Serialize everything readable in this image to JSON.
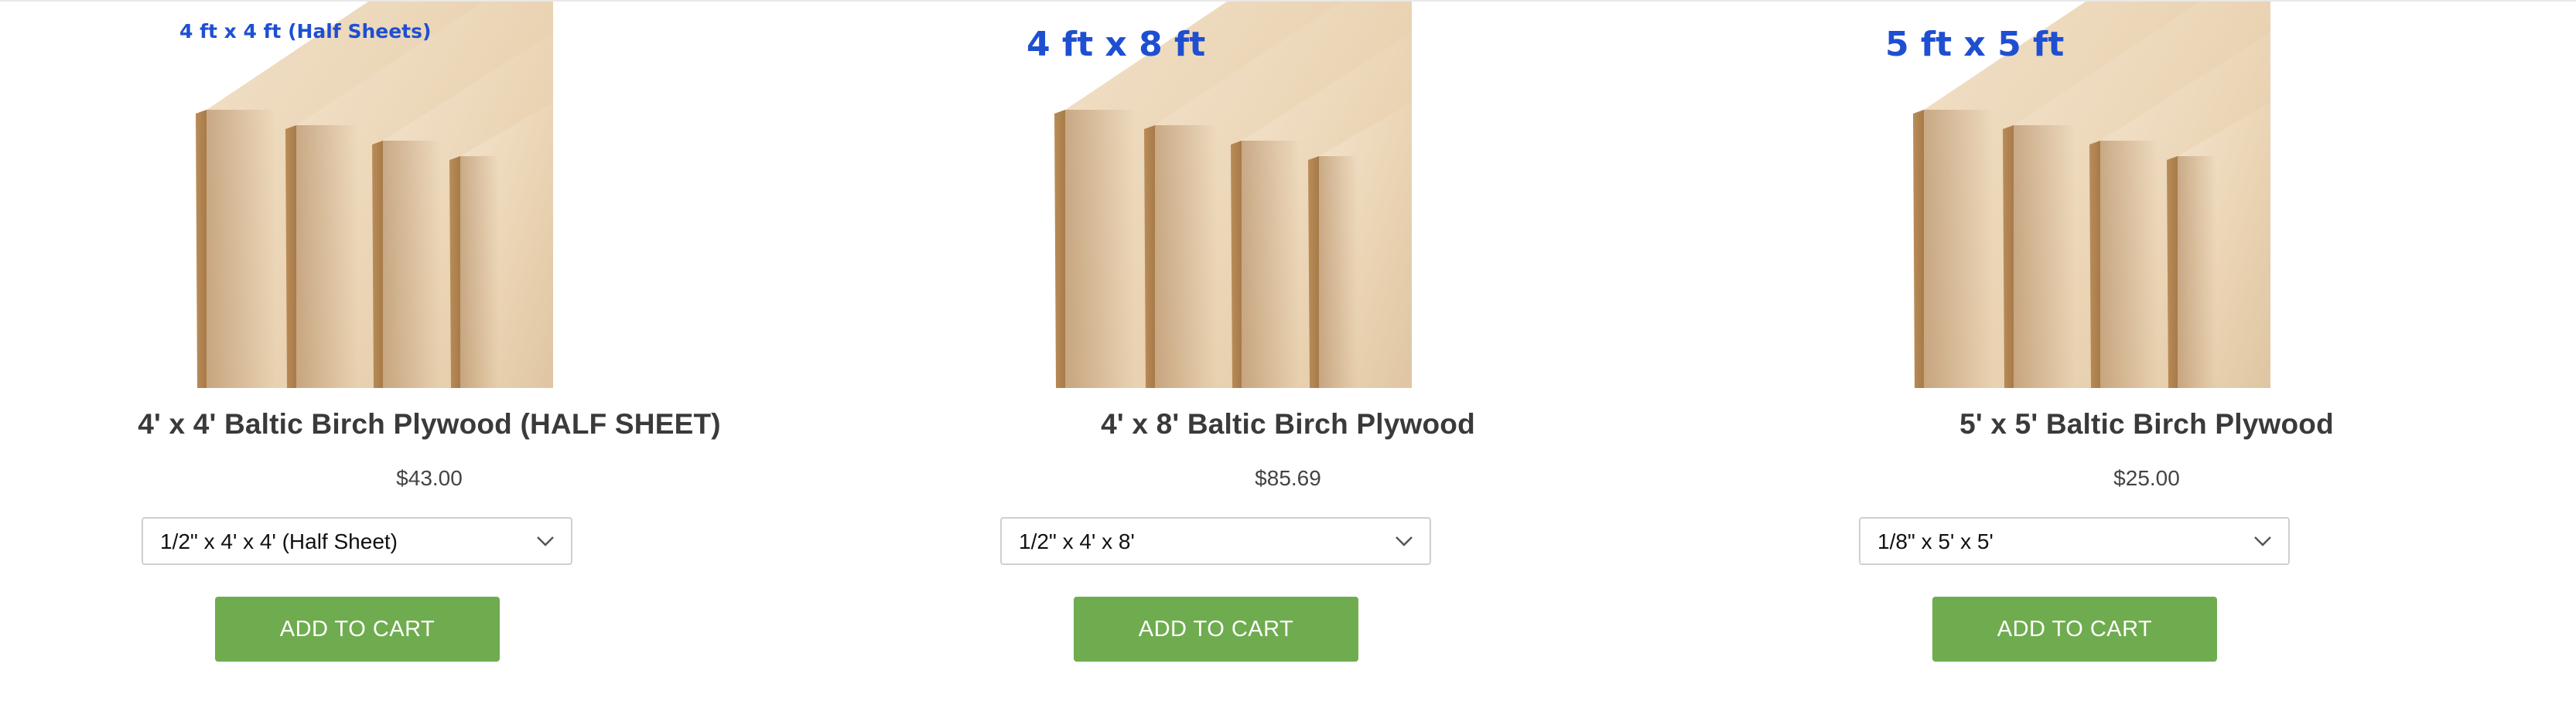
{
  "products": [
    {
      "image_caption": "4 ft x 4 ft (Half Sheets)",
      "title": "4' x 4' Baltic Birch Plywood (HALF SHEET)",
      "price": "$43.00",
      "selected_variant": "1/2\" x 4' x 4' (Half Sheet)",
      "button_label": "ADD TO CART"
    },
    {
      "image_caption": "4 ft x 8 ft",
      "title": "4' x 8' Baltic Birch Plywood",
      "price": "$85.69",
      "selected_variant": "1/2\" x 4' x 8'",
      "button_label": "ADD TO CART"
    },
    {
      "image_caption": "5 ft x 5 ft",
      "title": "5' x 5' Baltic Birch Plywood",
      "price": "$25.00",
      "selected_variant": "1/8\" x 5' x 5'",
      "button_label": "ADD TO CART"
    }
  ],
  "colors": {
    "button": "#6fac4f",
    "caption": "#1f4fd1",
    "title": "#3a3a3a"
  },
  "icons": {
    "select_arrow": "chevron-down-icon"
  }
}
